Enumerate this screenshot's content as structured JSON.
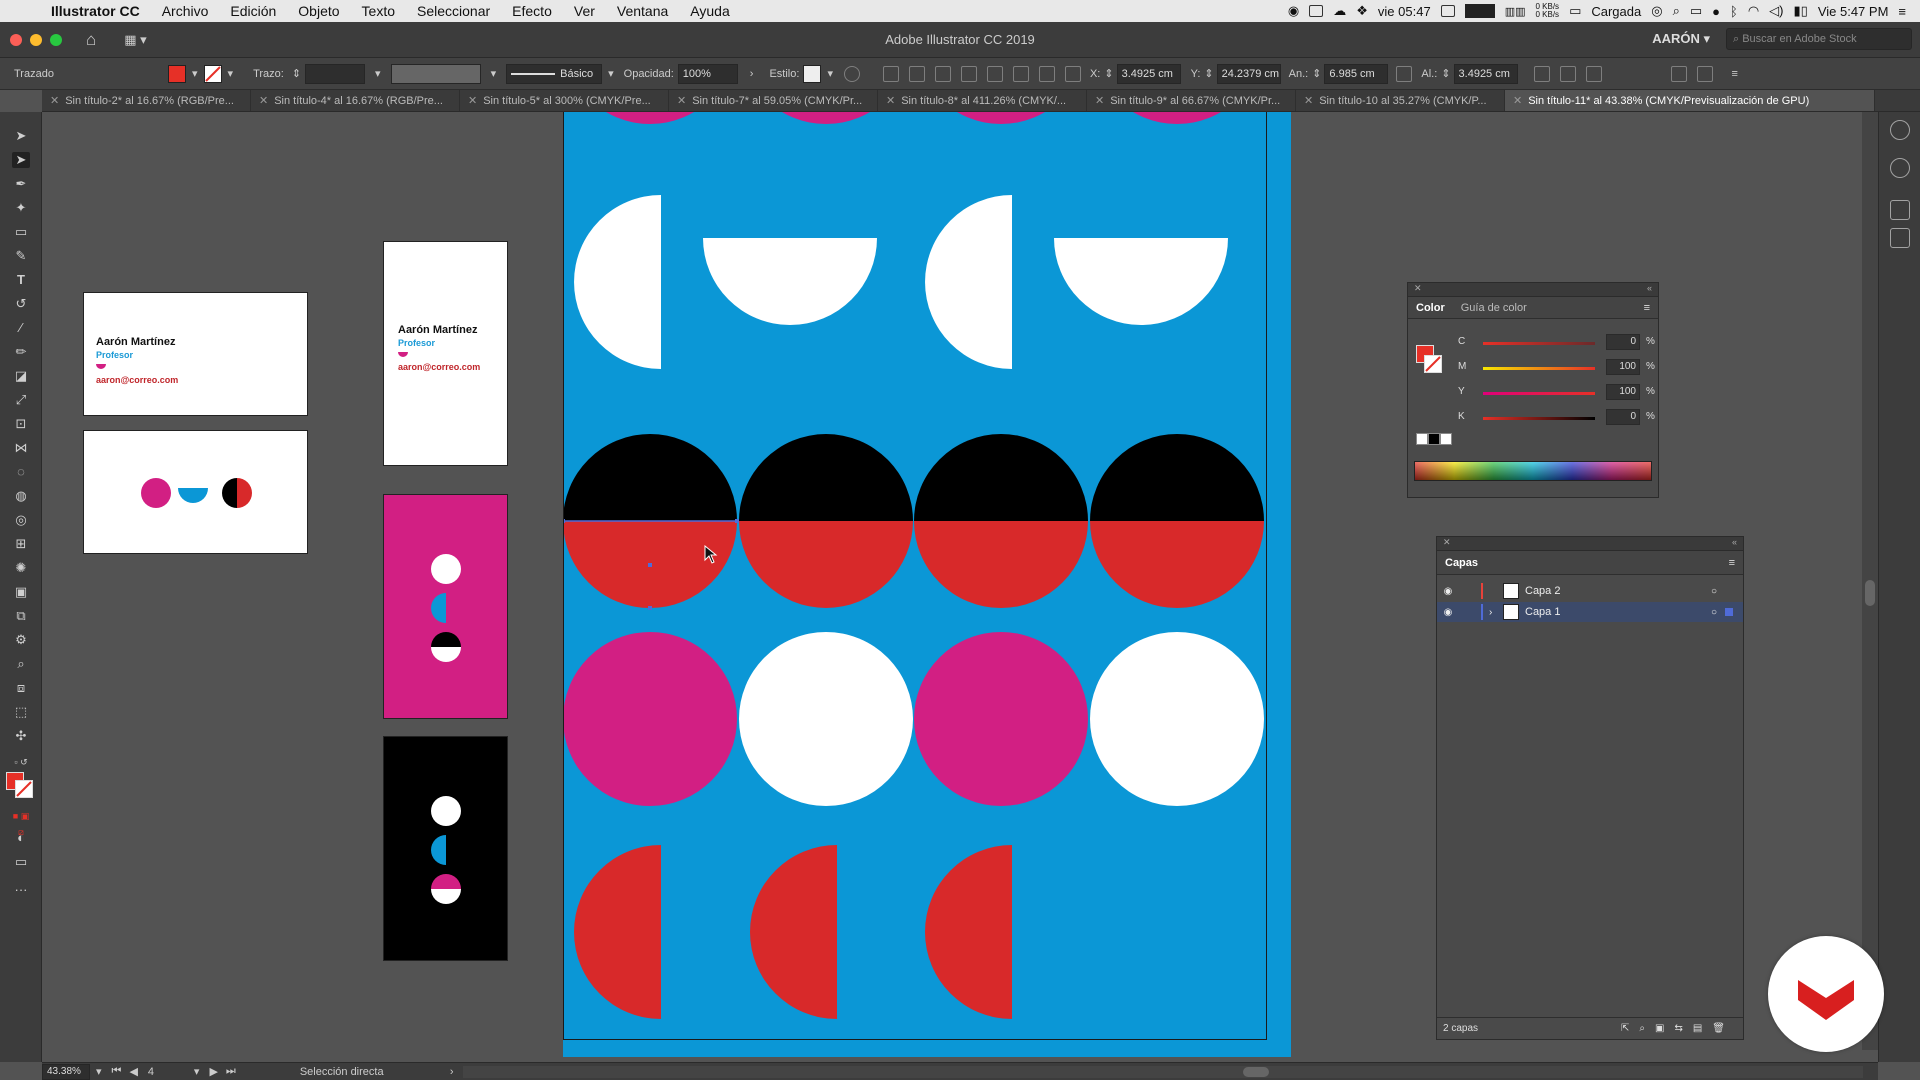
{
  "menubar": {
    "app_name": "Illustrator CC",
    "items": [
      "Archivo",
      "Edición",
      "Objeto",
      "Texto",
      "Seleccionar",
      "Efecto",
      "Ver",
      "Ventana",
      "Ayuda"
    ],
    "status": {
      "date_time_left": "vie 05:47",
      "net_up": "0 KB/s",
      "net_down": "0 KB/s",
      "battery": "Cargada",
      "clock": "Vie 5:47 PM"
    }
  },
  "titlebar": {
    "title": "Adobe Illustrator CC 2019",
    "user": "AARÓN",
    "search_placeholder": "Buscar en Adobe Stock"
  },
  "control": {
    "selection_label": "Trazado",
    "stroke_label": "Trazo:",
    "brush_style": "Básico",
    "opacity_label": "Opacidad:",
    "opacity_value": "100%",
    "style_label": "Estilo:",
    "x_label": "X:",
    "x_value": "3.4925 cm",
    "y_label": "Y:",
    "y_value": "24.2379 cm",
    "w_label": "An.:",
    "w_value": "6.985 cm",
    "h_label": "Al.:",
    "h_value": "3.4925 cm",
    "fill_color": "#e63027"
  },
  "tabs": [
    {
      "label": "Sin título-2* al 16.67% (RGB/Pre..."
    },
    {
      "label": "Sin título-4* al 16.67% (RGB/Pre..."
    },
    {
      "label": "Sin título-5* al 300% (CMYK/Pre..."
    },
    {
      "label": "Sin título-7* al 59.05% (CMYK/Pr..."
    },
    {
      "label": "Sin título-8* al 411.26% (CMYK/..."
    },
    {
      "label": "Sin título-9* al 66.67% (CMYK/Pr..."
    },
    {
      "label": "Sin título-10 al 35.27% (CMYK/P..."
    },
    {
      "label": "Sin título-11* al 43.38% (CMYK/Previsualización de GPU)",
      "active": true
    }
  ],
  "cards": {
    "name": "Aarón Martínez",
    "role": "Profesor",
    "email": "aaron@correo.com"
  },
  "colors": {
    "blue": "#0b97d6",
    "magenta": "#d21f83",
    "red": "#d8292a",
    "black": "#000000",
    "white": "#ffffff"
  },
  "color_panel": {
    "tabs": [
      "Color",
      "Guía de color"
    ],
    "channels": [
      {
        "label": "C",
        "value": "0",
        "unit": "%"
      },
      {
        "label": "M",
        "value": "100",
        "unit": "%"
      },
      {
        "label": "Y",
        "value": "100",
        "unit": "%"
      },
      {
        "label": "K",
        "value": "0",
        "unit": "%"
      }
    ]
  },
  "layers_panel": {
    "title": "Capas",
    "layers": [
      {
        "name": "Capa 2",
        "color": "#e8423a"
      },
      {
        "name": "Capa 1",
        "color": "#4f6bd8",
        "selected": true
      }
    ],
    "count": "2 capas"
  },
  "status": {
    "zoom": "43.38%",
    "artboard": "4",
    "tool": "Selección directa"
  }
}
